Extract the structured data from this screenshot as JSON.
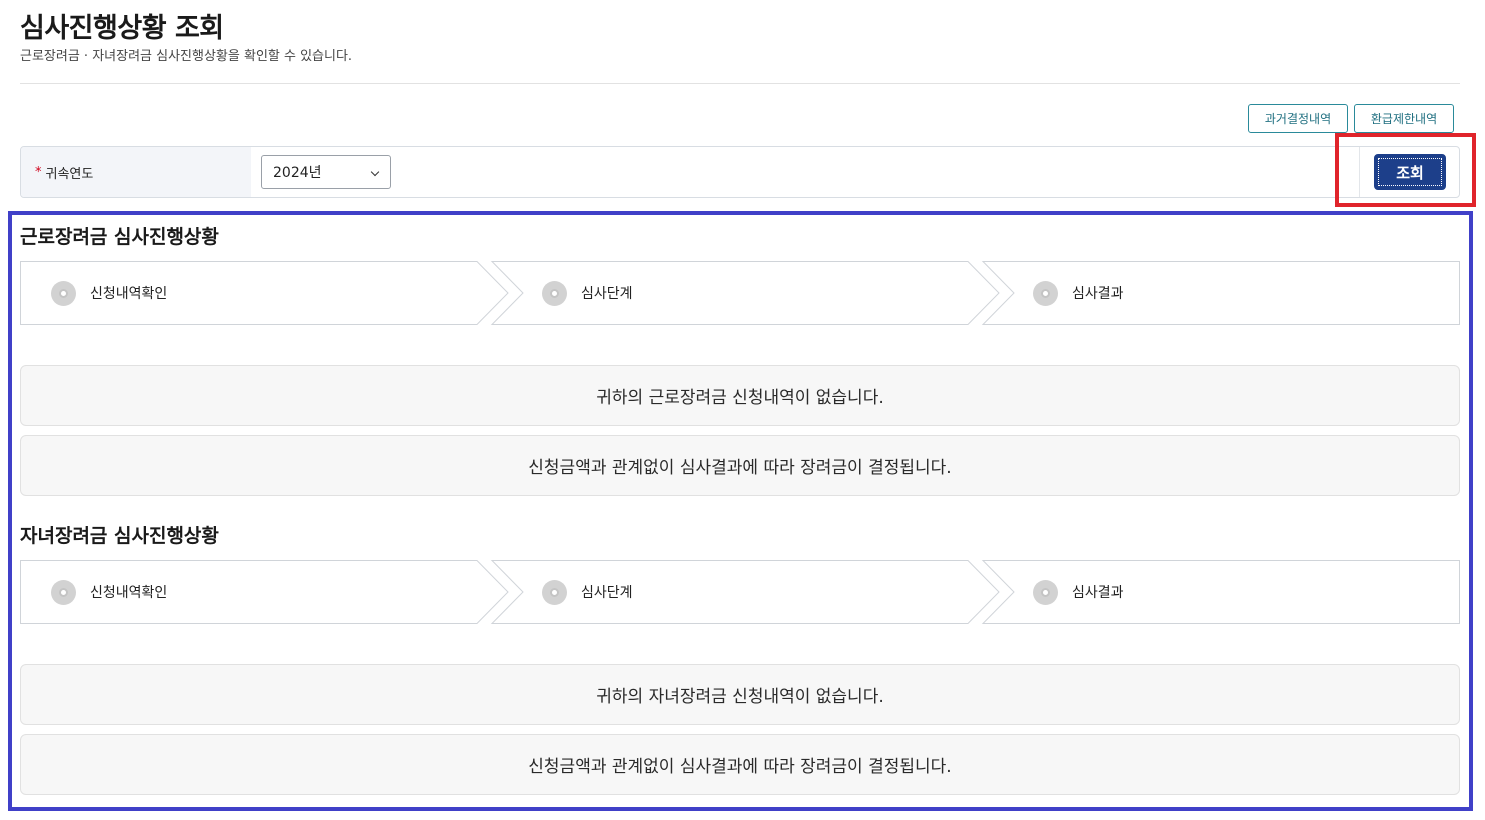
{
  "page": {
    "title": "심사진행상황 조회",
    "subtitle": "근로장려금 · 자녀장려금 심사진행상황을 확인할 수 있습니다."
  },
  "toolbar": {
    "past_decisions_label": "과거결정내역",
    "refund_limit_label": "환급제한내역"
  },
  "search": {
    "required_mark": "*",
    "year_label": "귀속연도",
    "year_value": "2024년",
    "submit_label": "조회"
  },
  "work_incentive": {
    "title": "근로장려금 심사진행상황",
    "steps": [
      "신청내역확인",
      "심사단계",
      "심사결과"
    ],
    "no_application_msg": "귀하의 근로장려금 신청내역이 없습니다.",
    "notice_msg": "신청금액과 관계없이 심사결과에 따라 장려금이 결정됩니다."
  },
  "child_incentive": {
    "title": "자녀장려금 심사진행상황",
    "steps": [
      "신청내역확인",
      "심사단계",
      "심사결과"
    ],
    "no_application_msg": "귀하의 자녀장려금 신청내역이 없습니다.",
    "notice_msg": "신청금액과 관계없이 심사결과에 따라 장려금이 결정됩니다."
  },
  "colors": {
    "primary_button": "#1d3f8a",
    "outline_button_border": "#2a8a9a",
    "highlight_red": "#e0242b",
    "highlight_blue": "#4040c8"
  }
}
